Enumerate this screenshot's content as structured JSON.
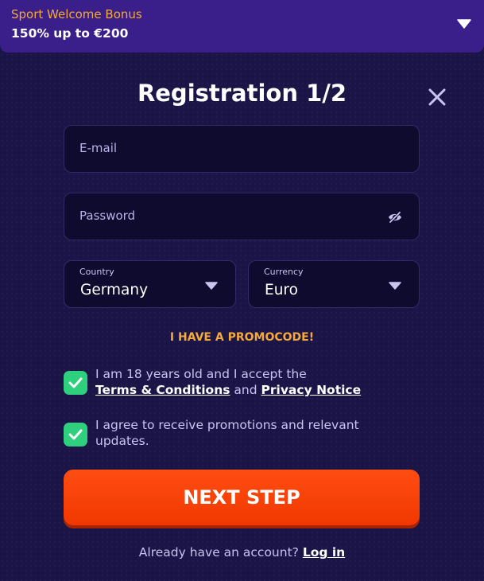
{
  "bonus": {
    "title": "Sport Welcome Bonus",
    "subtitle": "150% up to €200"
  },
  "form": {
    "title": "Registration 1/2",
    "email_placeholder": "E-mail",
    "password_placeholder": "Password",
    "country": {
      "label": "Country",
      "value": "Germany"
    },
    "currency": {
      "label": "Currency",
      "value": "Euro"
    },
    "promo_label": "I HAVE A PROMOCODE!",
    "age_consent": {
      "checked": true,
      "text_before": "I am 18 years old and I accept the",
      "terms_link": "Terms & Conditions",
      "and_text": "and",
      "privacy_link": "Privacy Notice"
    },
    "promo_consent": {
      "checked": true,
      "text": "I agree to receive promotions and relevant updates."
    },
    "next_label": "NEXT STEP",
    "login_prompt": "Already have an account?",
    "login_link": "Log in"
  },
  "icons": {
    "bonus_toggle": "caret-down-icon",
    "close": "close-icon",
    "password_visibility": "eye-slash-icon",
    "select_arrow": "caret-down-icon",
    "checkbox": "check-icon"
  },
  "colors": {
    "background": "#1b1547",
    "bonus_bar": "#3a1f8a",
    "accent_orange": "#f4a93a",
    "button": "#ff4d12",
    "checkbox": "#2fd07d",
    "field_background": "#0f0b2e"
  }
}
